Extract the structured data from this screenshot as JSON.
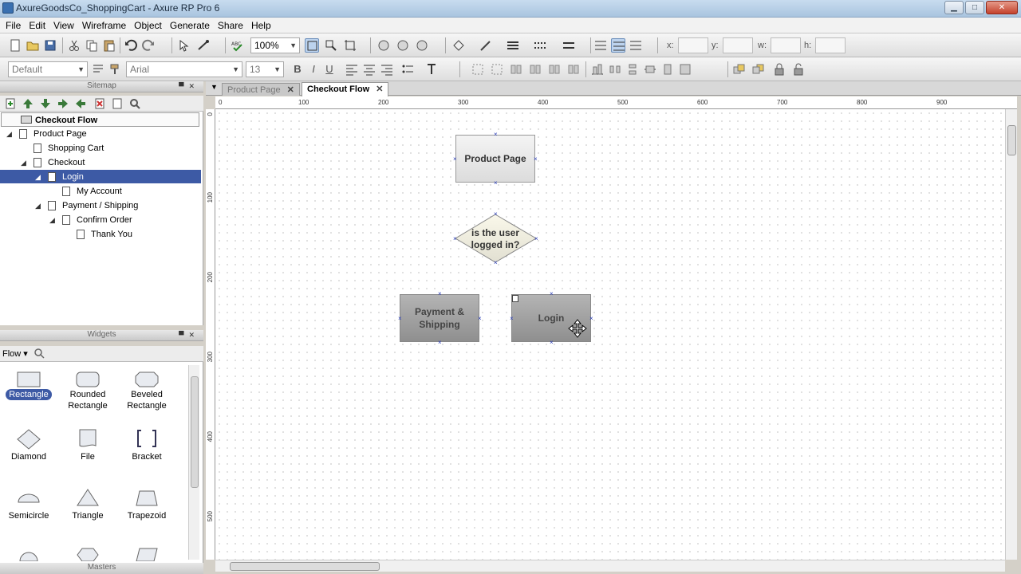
{
  "window": {
    "title": "AxureGoodsCo_ShoppingCart - Axure RP Pro 6",
    "min": "▁",
    "max": "□",
    "close": "✕"
  },
  "menu": [
    "File",
    "Edit",
    "View",
    "Wireframe",
    "Object",
    "Generate",
    "Share",
    "Help"
  ],
  "toolbar1": {
    "zoom": "100%",
    "x_label": "x:",
    "y_label": "y:",
    "w_label": "w:",
    "h_label": "h:"
  },
  "toolbar2": {
    "style": "Default",
    "font": "Arial",
    "size": "13",
    "bold": "B",
    "italic": "I",
    "underline": "U"
  },
  "sitemap": {
    "header": "Sitemap",
    "root": "Checkout Flow",
    "items": [
      {
        "label": "Product Page"
      },
      {
        "label": "Shopping Cart"
      },
      {
        "label": "Checkout"
      },
      {
        "label": "Login"
      },
      {
        "label": "My Account"
      },
      {
        "label": "Payment / Shipping"
      },
      {
        "label": "Confirm Order"
      },
      {
        "label": "Thank You"
      }
    ]
  },
  "widgets": {
    "header": "Widgets",
    "library": "Flow",
    "items": [
      "Rectangle",
      "Rounded Rectangle",
      "Beveled Rectangle",
      "Diamond",
      "File",
      "Bracket",
      "Semicircle",
      "Triangle",
      "Trapezoid"
    ]
  },
  "masters": {
    "header": "Masters"
  },
  "tabs": [
    {
      "label": "Product Page"
    },
    {
      "label": "Checkout Flow"
    }
  ],
  "ruler_h": [
    "0",
    "100",
    "200",
    "300",
    "400",
    "500",
    "600",
    "700",
    "800",
    "900"
  ],
  "ruler_v": [
    "0",
    "100",
    "200",
    "300",
    "400",
    "500"
  ],
  "canvas": {
    "product_page": "Product Page",
    "decision": "is the user logged in?",
    "payment": "Payment & Shipping",
    "login": "Login"
  },
  "colors": {
    "selection": "#3d5aa5",
    "handles": "#2a3db8"
  }
}
